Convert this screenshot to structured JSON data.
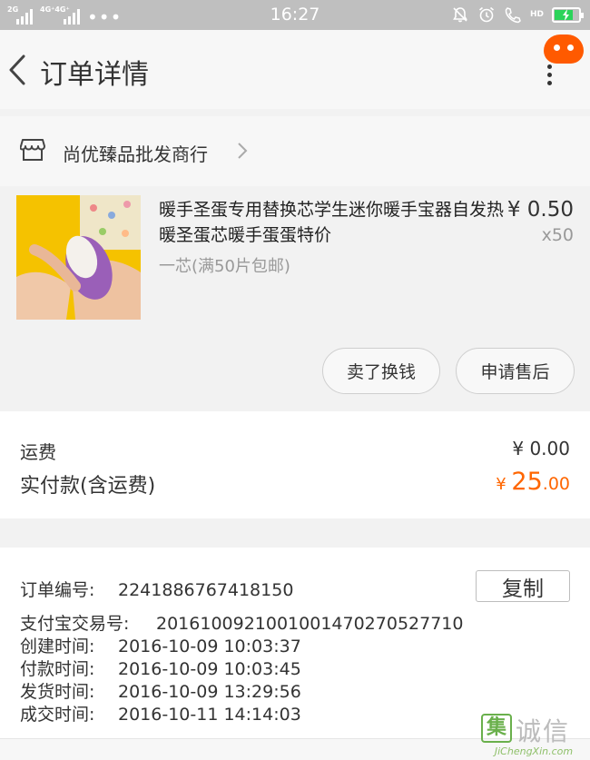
{
  "status_bar": {
    "sim1_label": "2G",
    "sim2_label": "4G⁺4G⁺",
    "more_dots": "•••",
    "time": "16:27",
    "hd_label": "HD",
    "battery_level": 0.75
  },
  "nav": {
    "title": "订单详情"
  },
  "store": {
    "name": "尚优臻品批发商行"
  },
  "product": {
    "title": "暖手圣蛋专用替换芯学生迷你暖手宝器自发热暖圣蛋芯暖手蛋蛋特价",
    "sku": "一芯(满50片包邮)",
    "price": "¥ 0.50",
    "quantity": "x50",
    "sell_button": "卖了换钱",
    "aftersale_button": "申请售后"
  },
  "payment": {
    "shipping_label": "运费",
    "shipping_value": "¥ 0.00",
    "paid_label": "实付款(含运费)",
    "paid_currency": "¥ ",
    "paid_int": "25",
    "paid_dec": ".00",
    "accent_color": "#ff6600"
  },
  "order_info": {
    "copy_button": "复制",
    "rows": [
      {
        "label": "订单编号:",
        "value": "2241886767418150"
      },
      {
        "label": "支付宝交易号:",
        "value": "2016100921001001470270527710"
      },
      {
        "label": "创建时间:",
        "value": "2016-10-09  10:03:37"
      },
      {
        "label": "付款时间:",
        "value": "2016-10-09  10:03:45"
      },
      {
        "label": "发货时间:",
        "value": "2016-10-09  13:29:56"
      },
      {
        "label": "成交时间:",
        "value": "2016-10-11  14:14:03"
      }
    ]
  },
  "watermark": {
    "logo_char": "集",
    "name": "诚信",
    "url": "JiChengXin.com"
  }
}
